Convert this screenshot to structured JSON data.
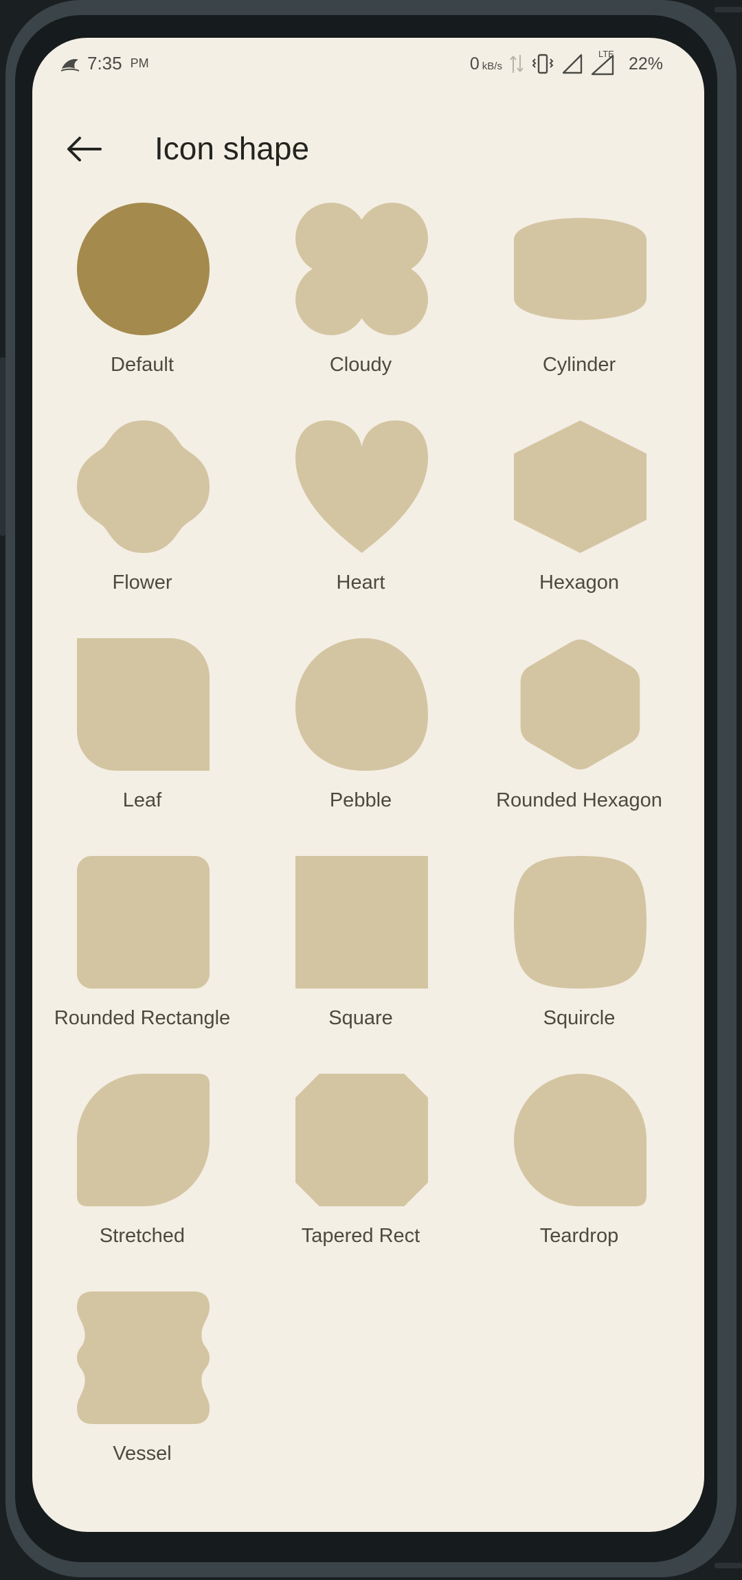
{
  "status_bar": {
    "time": "7:35",
    "ampm": "PM",
    "network_speed_value": "0",
    "network_speed_unit": "kB/s",
    "network_type": "LTE",
    "battery": "22%"
  },
  "header": {
    "back_icon": "arrow-left-icon",
    "title": "Icon shape"
  },
  "colors": {
    "selected": "#a48a4c",
    "unselected": "#d4c5a2",
    "background": "#f4efe5"
  },
  "shapes": [
    {
      "label": "Default",
      "selected": true
    },
    {
      "label": "Cloudy",
      "selected": false
    },
    {
      "label": "Cylinder",
      "selected": false
    },
    {
      "label": "Flower",
      "selected": false
    },
    {
      "label": "Heart",
      "selected": false
    },
    {
      "label": "Hexagon",
      "selected": false
    },
    {
      "label": "Leaf",
      "selected": false
    },
    {
      "label": "Pebble",
      "selected": false
    },
    {
      "label": "Rounded Hexagon",
      "selected": false
    },
    {
      "label": "Rounded Rectangle",
      "selected": false
    },
    {
      "label": "Square",
      "selected": false
    },
    {
      "label": "Squircle",
      "selected": false
    },
    {
      "label": "Stretched",
      "selected": false
    },
    {
      "label": "Tapered Rect",
      "selected": false
    },
    {
      "label": "Teardrop",
      "selected": false
    },
    {
      "label": "Vessel",
      "selected": false
    }
  ]
}
